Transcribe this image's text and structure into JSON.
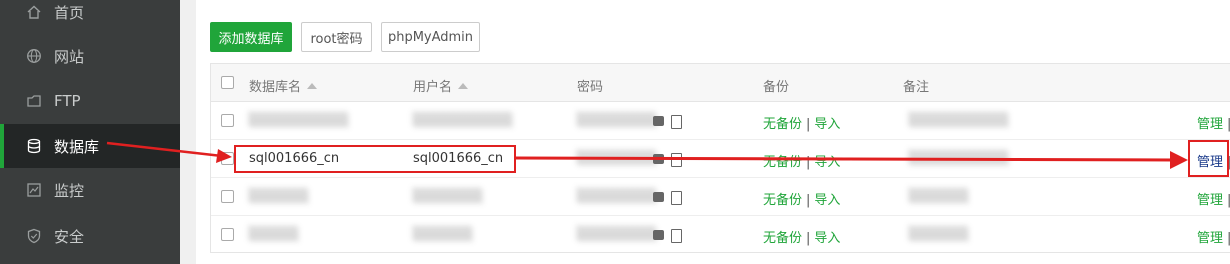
{
  "sidebar": {
    "items": [
      {
        "label": "首页",
        "icon": "home-icon"
      },
      {
        "label": "网站",
        "icon": "globe-icon"
      },
      {
        "label": "FTP",
        "icon": "ftp-icon"
      },
      {
        "label": "数据库",
        "icon": "database-icon",
        "active": true
      },
      {
        "label": "监控",
        "icon": "monitor-icon"
      },
      {
        "label": "安全",
        "icon": "shield-icon"
      }
    ]
  },
  "toolbar": {
    "add_database_label": "添加数据库",
    "root_password_label": "root密码",
    "phpmyadmin_label": "phpMyAdmin"
  },
  "table": {
    "headers": {
      "name": "数据库名",
      "user": "用户名",
      "password": "密码",
      "backup": "备份",
      "note": "备注"
    },
    "rows": [
      {
        "name": "",
        "user": "",
        "backup": "无备份",
        "import": "导入",
        "note": "",
        "manage": "管理"
      },
      {
        "name": "sql001666_cn",
        "user": "sql001666_cn",
        "backup": "无备份",
        "import": "导入",
        "note": "",
        "manage": "管理"
      },
      {
        "name": "",
        "user": "",
        "backup": "无备份",
        "import": "导入",
        "note": "",
        "manage": "管理"
      },
      {
        "name": "",
        "user": "",
        "backup": "无备份",
        "import": "导入",
        "note": "",
        "manage": "管理"
      }
    ]
  },
  "colors": {
    "accent": "#20a53a",
    "sidebar_bg": "#3a3d3d",
    "annotation": "#e02020"
  }
}
